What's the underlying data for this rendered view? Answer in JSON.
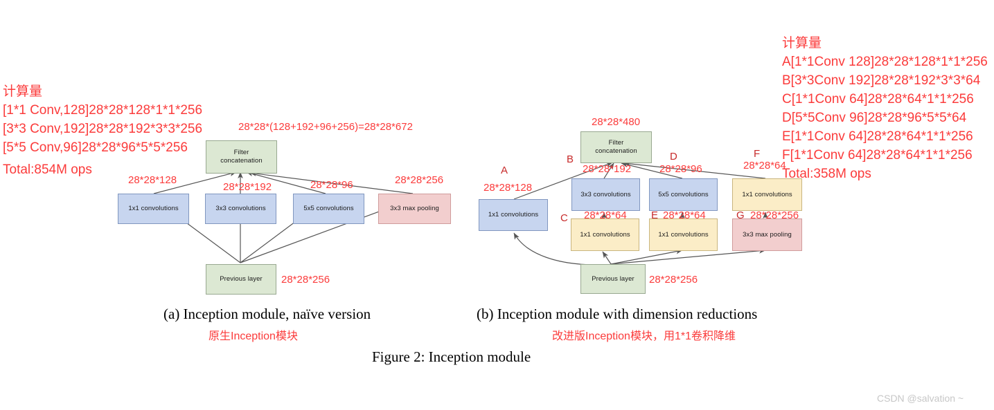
{
  "colors": {
    "red_annotation": "#fb3b3b",
    "letter_label": "#c72a2a",
    "box_blue": "#c7d5ef",
    "box_green": "#dce8d3",
    "box_pink": "#f2cece",
    "box_yellow": "#fbedc7",
    "arrow": "#555555",
    "watermark": "#c7c7c7"
  },
  "left_annotation": {
    "text": "计算量\n[1*1 Conv,128]28*28*128*1*1*256\n[3*3 Conv,192]28*28*192*3*3*256\n[5*5 Conv,96]28*28*96*5*5*256"
  },
  "left_total": {
    "text": "Total:854M ops"
  },
  "right_annotation": {
    "text": "计算量\nA[1*1Conv 128]28*28*128*1*1*256\nB[3*3Conv 192]28*28*192*3*3*64\nC[1*1Conv 64]28*28*64*1*1*256\nD[5*5Conv 96]28*28*96*5*5*64\nE[1*1Conv 64]28*28*64*1*1*256\nF[1*1Conv 64]28*28*64*1*1*256\nTotal:358M ops"
  },
  "diagram_a": {
    "top_formula": "28*28*(128+192+96+256)=28*28*672",
    "nodes": {
      "filter_concat": "Filter\nconcatenation",
      "conv1x1": "1x1 convolutions",
      "conv3x3": "3x3 convolutions",
      "conv5x5": "5x5 convolutions",
      "maxpool": "3x3 max pooling",
      "previous_layer": "Previous layer"
    },
    "dims": {
      "conv1x1": "28*28*128",
      "conv3x3": "28*28*192",
      "conv5x5": "28*28*96",
      "maxpool": "28*28*256",
      "previous_layer": "28*28*256"
    },
    "caption_en": "(a)  Inception module, naïve version",
    "caption_zh": "原生Inception模块"
  },
  "diagram_b": {
    "top_dim": "28*28*480",
    "nodes": {
      "filter_concat": "Filter\nconcatenation",
      "conv1x1_a": "1x1 convolutions",
      "conv3x3_b": "3x3 convolutions",
      "conv5x5_d": "5x5 convolutions",
      "conv1x1_f": "1x1 convolutions",
      "conv1x1_c": "1x1 convolutions",
      "conv1x1_e": "1x1 convolutions",
      "maxpool_g": "3x3 max pooling",
      "previous_layer": "Previous layer"
    },
    "letters": {
      "a": "A",
      "b": "B",
      "c": "C",
      "d": "D",
      "e": "E",
      "f": "F",
      "g": "G"
    },
    "dims": {
      "a": "28*28*128",
      "b": "28*28*192",
      "c": "28*28*64",
      "d": "28*28*96",
      "e": "28*28*64",
      "f": "28*28*64",
      "g": "28*28*256",
      "previous_layer": "28*28*256"
    },
    "caption_en": "(b)  Inception module with dimension reductions",
    "caption_zh": "改进版Inception模块，用1*1卷积降维"
  },
  "figure_caption": "Figure 2: Inception module",
  "watermark": "CSDN @salvation ~"
}
